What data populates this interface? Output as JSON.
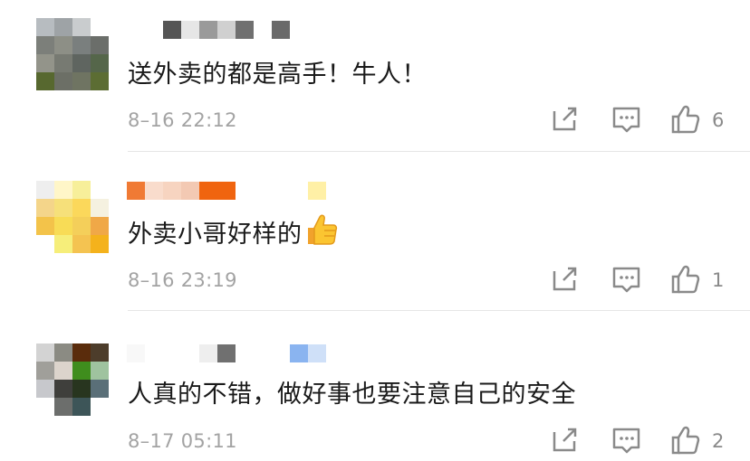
{
  "comments": [
    {
      "text": "送外卖的都是高手！牛人！",
      "time": "8–16 22:12",
      "likes": "6",
      "avatar": "avatar-1"
    },
    {
      "text": "外卖小哥好样的",
      "emoji": "thumbs-up-emoji",
      "time": "8–16 23:19",
      "likes": "1",
      "avatar": "avatar-2"
    },
    {
      "text": "人真的不错，做好事也要注意自己的安全",
      "time": "8–17 05:11",
      "likes": "2",
      "avatar": "avatar-3"
    }
  ],
  "icons": {
    "share": "share-icon",
    "reply": "comment-icon",
    "like": "thumbs-up-icon"
  },
  "colors": {
    "text": "#1a1a1a",
    "meta": "#a3a3a3",
    "icon": "#8a8a8a",
    "divider": "#e6e6e6"
  }
}
